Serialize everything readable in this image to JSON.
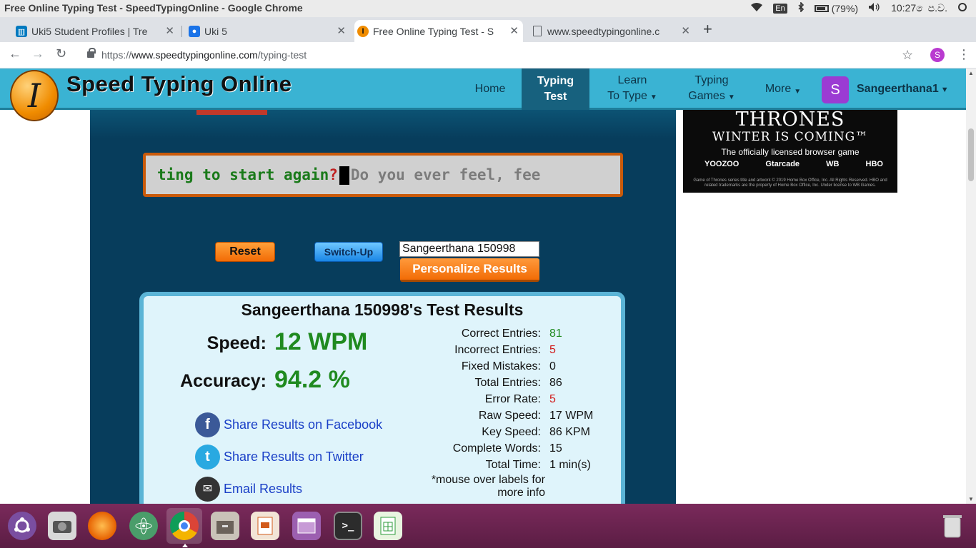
{
  "os": {
    "window_title": "Free Online Typing Test - SpeedTypingOnline - Google Chrome",
    "lang": "En",
    "battery": "(79%)",
    "clock": "10:27 ෙප.ව."
  },
  "browser": {
    "tabs": [
      {
        "label": "Uki5 Student Profiles | Tre",
        "icon": "trello-icon",
        "active": false
      },
      {
        "label": "Uki 5",
        "icon": "classroom-icon",
        "active": false
      },
      {
        "label": "Free Online Typing Test - S",
        "icon": "speedtyping-icon",
        "active": true
      },
      {
        "label": "www.speedtypingonline.c",
        "icon": "page-icon",
        "active": false
      }
    ],
    "url_scheme": "https://",
    "url_host": "www.speedtypingonline.com",
    "url_path": "/typing-test",
    "profile_initial": "S"
  },
  "site": {
    "logo_letter": "I",
    "name": "Speed Typing Online",
    "nav": {
      "home": "Home",
      "typing_test_1": "Typing",
      "typing_test_2": "Test",
      "learn_1": "Learn",
      "learn_2": "To Type",
      "games_1": "Typing",
      "games_2": "Games",
      "more": "More"
    },
    "user_initial": "S",
    "user_name": "Sangeerthana1"
  },
  "test": {
    "typed_text": "ting to start again",
    "error_char": "?",
    "pending_text": "Do you ever feel, fee",
    "reset_label": "Reset",
    "switch_label": "Switch-Up",
    "name_value": "Sangeerthana 150998",
    "personalize_label": "Personalize Results"
  },
  "results": {
    "title": "Sangeerthana 150998's Test Results",
    "speed_label": "Speed:",
    "speed_value": "12 WPM",
    "accuracy_label": "Accuracy:",
    "accuracy_value": "94.2 %",
    "share": {
      "facebook": "Share Results on Facebook",
      "twitter": "Share Results on Twitter",
      "email": "Email Results"
    },
    "stats": [
      {
        "label": "Correct Entries:",
        "value": "81",
        "color": "green"
      },
      {
        "label": "Incorrect Entries:",
        "value": "5",
        "color": "red"
      },
      {
        "label": "Fixed Mistakes:",
        "value": "0",
        "color": ""
      },
      {
        "label": "Total Entries:",
        "value": "86",
        "color": ""
      },
      {
        "label": "Error Rate:",
        "value": "5",
        "color": "red"
      },
      {
        "label": "Raw Speed:",
        "value": "17 WPM",
        "color": ""
      },
      {
        "label": "Key Speed:",
        "value": "86 KPM",
        "color": ""
      },
      {
        "label": "Complete Words:",
        "value": "15",
        "color": ""
      },
      {
        "label": "Total Time:",
        "value": "1 min(s)",
        "color": ""
      }
    ],
    "note_1": "*mouse over labels for",
    "note_2": "more info"
  },
  "ad": {
    "title": "THRONES",
    "tagline": "WINTER IS COMING™",
    "sub": "The officially licensed browser game",
    "logo_1": "YOOZOO",
    "logo_2": "Gtarcade",
    "logo_3": "WB",
    "logo_4": "HBO",
    "fine_print": "Game of Thrones series title and artwork © 2019 Home Box Office, Inc. All Rights Reserved. HBO and related trademarks are the property of Home Box Office, Inc. Under license to WB Games."
  },
  "colors": {
    "site_header": "#3ab3d3",
    "panel": "#073d5c",
    "correct": "#1f8a1f",
    "error": "#d11a1a",
    "taskbar": "#5b1d44"
  }
}
